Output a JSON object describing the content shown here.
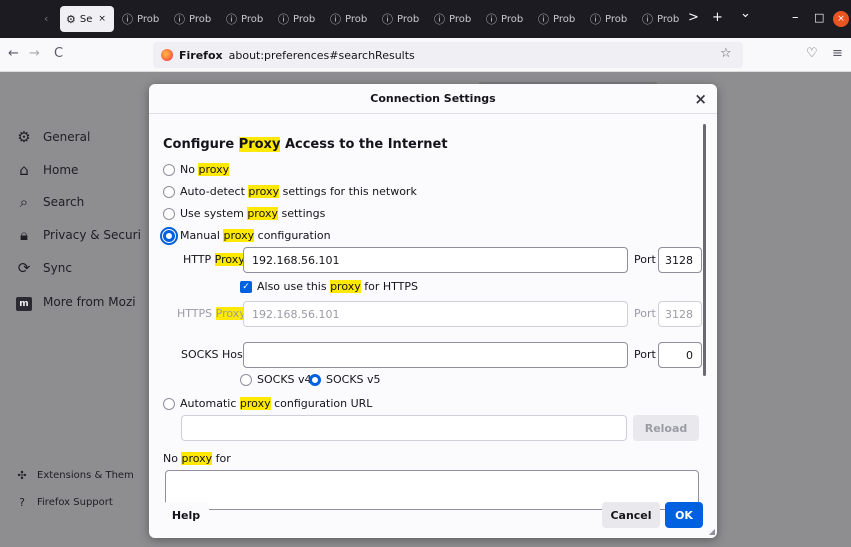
{
  "tabs": [
    {
      "label": "Se",
      "icon": "gear-icon",
      "active": true
    },
    {
      "label": "Prob",
      "icon": "info-icon"
    },
    {
      "label": "Prob",
      "icon": "info-icon"
    },
    {
      "label": "Prob",
      "icon": "info-icon"
    },
    {
      "label": "Prob",
      "icon": "info-icon"
    },
    {
      "label": "Prob",
      "icon": "info-icon"
    },
    {
      "label": "Prob",
      "icon": "info-icon"
    },
    {
      "label": "Prob",
      "icon": "info-icon"
    },
    {
      "label": "Prob",
      "icon": "info-icon"
    },
    {
      "label": "Prob",
      "icon": "info-icon"
    },
    {
      "label": "Prob",
      "icon": "info-icon"
    },
    {
      "label": "Prob",
      "icon": "info-icon"
    }
  ],
  "tabbar_controls": {
    "scroll_right": ">",
    "new_tab": "+",
    "list_all": "⌄",
    "minimize": "–",
    "maximize": "□",
    "close": "×"
  },
  "navbar": {
    "back": "←",
    "forward": "→",
    "reload": "C",
    "identity": "Firefox",
    "url": "about:preferences#searchResults",
    "bookmark": "☆",
    "pocket": "♡",
    "menu": "≡"
  },
  "sidebar": {
    "items": [
      {
        "label": "General",
        "icon": "gear-icon"
      },
      {
        "label": "Home",
        "icon": "home-icon"
      },
      {
        "label": "Search",
        "icon": "search-icon"
      },
      {
        "label": "Privacy & Securi",
        "icon": "lock-icon"
      },
      {
        "label": "Sync",
        "icon": "sync-icon"
      },
      {
        "label": "More from Mozi",
        "icon": "mozilla-icon"
      }
    ],
    "footer": [
      {
        "label": "Extensions & Them",
        "icon": "puzzle-icon"
      },
      {
        "label": "Firefox Support",
        "icon": "help-icon"
      }
    ]
  },
  "dialog": {
    "title": "Connection Settings",
    "close": "×",
    "heading": {
      "pre": "Configure ",
      "hl": "Proxy",
      "post": " Access to the Internet"
    },
    "options": {
      "no_proxy": {
        "pre": "No ",
        "hl": "proxy",
        "post": ""
      },
      "auto_detect": {
        "pre": "Auto-detect ",
        "hl": "proxy",
        "post": " settings for this network"
      },
      "system": {
        "pre": "Use system ",
        "hl": "proxy",
        "post": " settings"
      },
      "manual": {
        "pre": "Manual ",
        "hl": "proxy",
        "post": " configuration"
      },
      "auto_url": {
        "pre": "Automatic ",
        "hl": "proxy",
        "post": " configuration URL"
      }
    },
    "selected_option": "manual",
    "http": {
      "label_pre": "HTTP ",
      "label_hl": "Proxy",
      "value": "192.168.56.101",
      "port_label": "Port",
      "port": "3128"
    },
    "also_https": {
      "pre": "Also use this ",
      "hl": "proxy",
      "post": " for HTTPS",
      "checked": true
    },
    "https": {
      "label_pre": "HTTPS ",
      "label_hl": "Proxy",
      "value": "192.168.56.101",
      "port_label": "Port",
      "port": "3128"
    },
    "socks": {
      "label": "SOCKS Host",
      "value": "",
      "port_label": "Port",
      "port": "0",
      "v4": "SOCKS v4",
      "v5": "SOCKS v5",
      "selected": "v5"
    },
    "auto_url_value": "",
    "reload": "Reload",
    "no_proxy_for": {
      "pre": "No ",
      "hl": "proxy",
      "post": " for"
    },
    "no_proxy_for_value": "",
    "help": "Help",
    "cancel": "Cancel",
    "ok": "OK"
  },
  "colors": {
    "accent": "#0061e0",
    "highlight": "#ffe900",
    "tabbar": "#1c1b22",
    "close_button": "#e95420"
  }
}
